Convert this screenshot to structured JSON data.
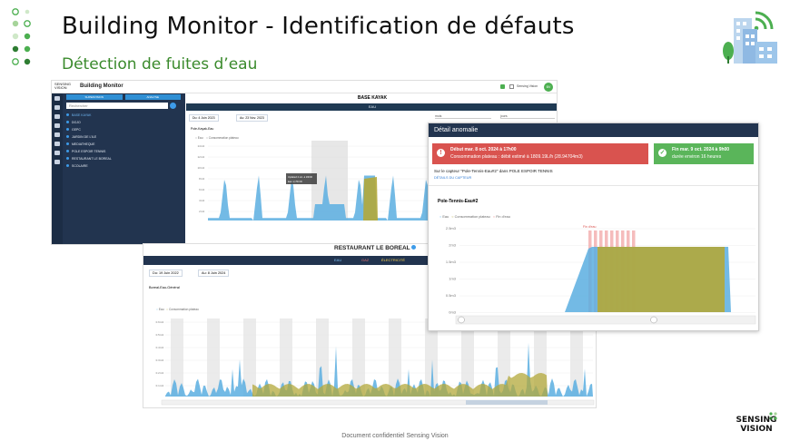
{
  "slide": {
    "title": "Building Monitor - Identification de défauts",
    "subtitle": "Détection de fuites d’eau",
    "footer": "Document confidentiel Sensing Vision",
    "logo_line1": "SENSING",
    "logo_line2": "VISION"
  },
  "app1": {
    "brand_small": "SENSING VISION",
    "brand": "Building Monitor",
    "brand_accent": "#4caf50",
    "user_initials": "BV",
    "user_label": "Sensing Vision",
    "sidebar_tabs": [
      "SUPERVISION",
      "ANALYSE"
    ],
    "search_placeholder": "Rechercher",
    "sidebar_items": [
      "BASE KAYAK",
      "DOJO",
      "GEPC",
      "JARDIN DE L’ILE",
      "MEDIATHEQUE",
      "POLE ESPOIR TENNIS",
      "RESTAURANT LE BOREAL",
      "SCOLAIRE"
    ],
    "site_title": "BASE KAYAK",
    "utility_tab": "EAU",
    "date_from": "Du: 4 Juin 2023",
    "date_to": "Au: 23 Nov. 2023",
    "select1": "mois",
    "select2": "jours",
    "chart_title": "Pole-Kayak-Eau",
    "legend": [
      "Eau",
      "Consommation plateau"
    ],
    "yticks": [
      "14m3",
      "12m3",
      "10m3",
      "8m3",
      "6m3",
      "4m3",
      "2m3"
    ],
    "tooltip_lines": [
      "Updated 4 oct. à 16h00",
      "Eau: 2,763 l/h"
    ]
  },
  "app3": {
    "site_title": "RESTAURANT LE BOREAL",
    "tabs": [
      "EAU",
      "GAZ",
      "ÉLECTRICITÉ"
    ],
    "date_from": "Du: 19 Juin 2022",
    "date_to": "Au: 8 Juin 2024",
    "chart_title": "Boreal-Eau-Général",
    "legend": [
      "Eau",
      "Consommation plateau"
    ],
    "yticks": [
      "0.6m3",
      "0.5m3",
      "0.4m3",
      "0.3m3",
      "0.2m3",
      "0.1m3"
    ]
  },
  "detail": {
    "header": "Détail anomalie",
    "start_title": "Début mar. 8 oct. 2024 à 17h00",
    "start_text": "Consommation plateau : débit estimé à 1809.19L/h (28.94704m3)",
    "end_title": "Fin mar. 9 oct. 2024 à 9h00",
    "end_text": "durée environ 16 heures",
    "sensor_text": "Sur le capteur \"Pole-Tennis-Eau#2\" dans POLE ESPOIR TENNIS",
    "link": "DÉTAILS DU CAPTEUR",
    "chart_title": "Pole-Tennis-Eau#2",
    "legend": [
      "Eau",
      "Consommation plateau",
      "Fin d’eau"
    ],
    "yticks": [
      "2.5m3",
      "2m3",
      "1.5m3",
      "1m3",
      "0.5m3",
      "0m3"
    ],
    "peak_label": "Fin d’eau",
    "colors": {
      "red": "#d9534f",
      "green": "#5ab55a",
      "water": "#5aaee0",
      "plateau": "#b3a83a",
      "header": "#22344f"
    }
  }
}
